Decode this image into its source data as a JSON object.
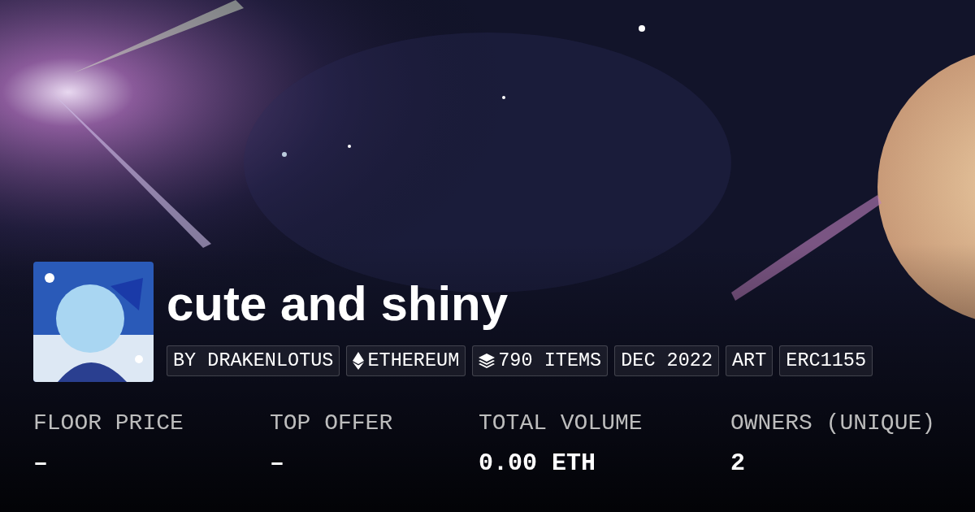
{
  "collection": {
    "title": "cute and shiny",
    "tags": [
      {
        "kind": "text",
        "label": "BY DRAKENLOTUS"
      },
      {
        "kind": "chain",
        "label": "ETHEREUM"
      },
      {
        "kind": "items",
        "label": "790 ITEMS"
      },
      {
        "kind": "text",
        "label": "DEC 2022"
      },
      {
        "kind": "text",
        "label": "ART"
      },
      {
        "kind": "text",
        "label": "ERC1155"
      }
    ]
  },
  "stats": [
    {
      "label": "FLOOR PRICE",
      "value": "–"
    },
    {
      "label": "TOP OFFER",
      "value": "–"
    },
    {
      "label": "TOTAL VOLUME",
      "value": "0.00 ETH"
    },
    {
      "label": "OWNERS (UNIQUE)",
      "value": "2"
    }
  ]
}
